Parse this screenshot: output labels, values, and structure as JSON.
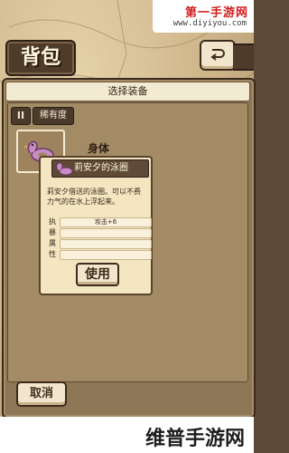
{
  "watermark": {
    "top_title": "第一手游网",
    "top_url": "www.diyiyou.com",
    "bottom_text": "维普手游网"
  },
  "header": {
    "title": "背包",
    "back_icon": "back-arrow-icon"
  },
  "panel": {
    "title": "选择装备",
    "sort_icon_text": "II",
    "sort_label": "稀有度"
  },
  "item": {
    "category": "身体",
    "name": "莉安夕的泳圈",
    "description": "莉安夕借送的泳圈。可以不费力气的在水上浮起来。",
    "stats": [
      {
        "label": "执",
        "value": "攻击+6"
      },
      {
        "label": "暴",
        "value": ""
      },
      {
        "label": "属",
        "value": ""
      },
      {
        "label": "性",
        "value": ""
      }
    ],
    "use_label": "使用",
    "icon": "swim-ring-icon",
    "icon_color": "#c98bc4"
  },
  "footer": {
    "cancel_label": "取消"
  }
}
